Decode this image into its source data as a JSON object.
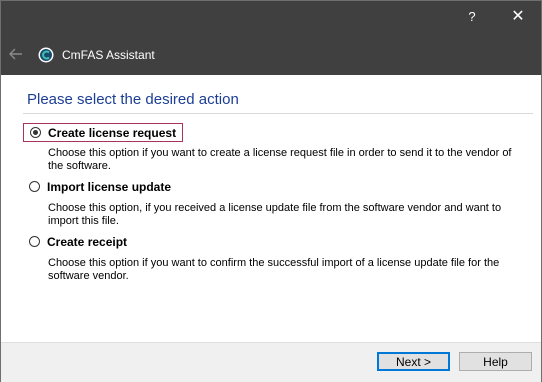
{
  "window": {
    "help_label": "?",
    "close_label": "✕",
    "app_title": "CmFAS Assistant"
  },
  "content": {
    "heading": "Please select the desired action",
    "options": [
      {
        "label": "Create license request",
        "description": "Choose this option if you want to create a license request file in order to send it to the vendor of the software.",
        "selected": true
      },
      {
        "label": "Import license update",
        "description": "Choose this option, if you received a license update file from the software vendor and want to import this file.",
        "selected": false
      },
      {
        "label": "Create receipt",
        "description": "Choose this option if you want to confirm the successful import of a license update file for the software vendor.",
        "selected": false
      }
    ]
  },
  "footer": {
    "next_label": "Next >",
    "help_label": "Help"
  },
  "colors": {
    "titlebar": "#404040",
    "heading": "#1c3f94",
    "selection_border": "#a8345e",
    "default_button_border": "#0078d7"
  }
}
